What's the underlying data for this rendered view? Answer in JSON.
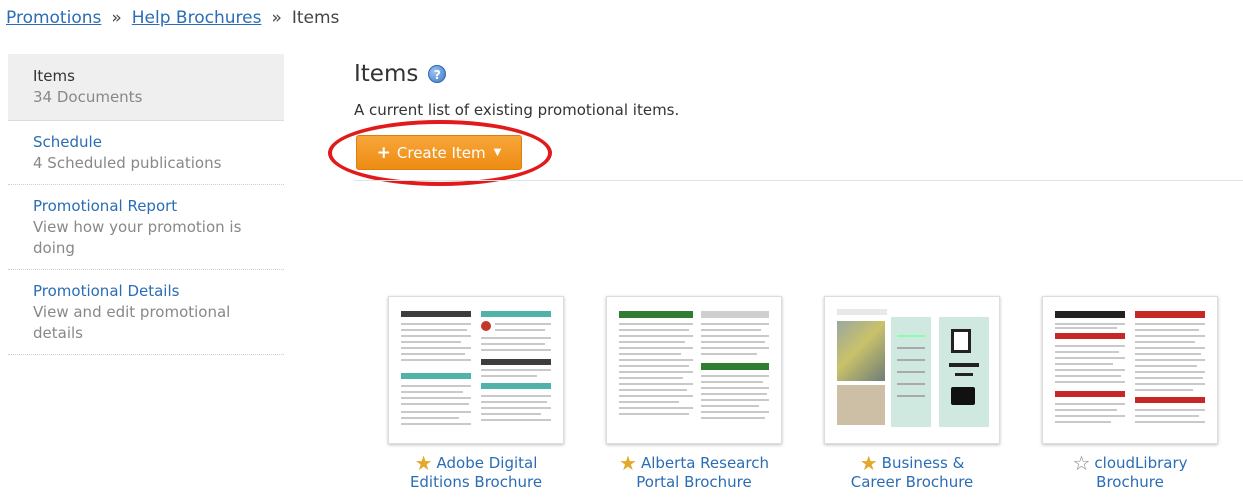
{
  "breadcrumb": {
    "items": [
      "Promotions",
      "Help Brochures"
    ],
    "current": "Items",
    "separator": "»"
  },
  "sidebar": {
    "items": [
      {
        "title": "Items",
        "desc": "34 Documents"
      },
      {
        "title": "Schedule",
        "desc": "4 Scheduled publications"
      },
      {
        "title": "Promotional Report",
        "desc": "View how your promotion is doing"
      },
      {
        "title": "Promotional Details",
        "desc": "View and edit promotional details"
      }
    ]
  },
  "main": {
    "title": "Items",
    "help_icon": "?",
    "description": "A current list of existing promotional items.",
    "create_button": {
      "plus": "+",
      "label": "Create Item",
      "caret": "▼"
    }
  },
  "brochures": [
    {
      "label_line1": "Adobe Digital",
      "label_line2": "Editions Brochure",
      "starred": true,
      "star": "★"
    },
    {
      "label_line1": "Alberta Research",
      "label_line2": "Portal Brochure",
      "starred": true,
      "star": "★"
    },
    {
      "label_line1": "Business &",
      "label_line2": "Career Brochure",
      "starred": true,
      "star": "★"
    },
    {
      "label_line1": "cloudLibrary",
      "label_line2": "Brochure",
      "starred": false,
      "star": "☆"
    }
  ],
  "colors": {
    "link": "#2a6db5",
    "button_orange": "#ee8c12",
    "annotation_red": "#e11b1b",
    "star_gold": "#e3a92b"
  }
}
